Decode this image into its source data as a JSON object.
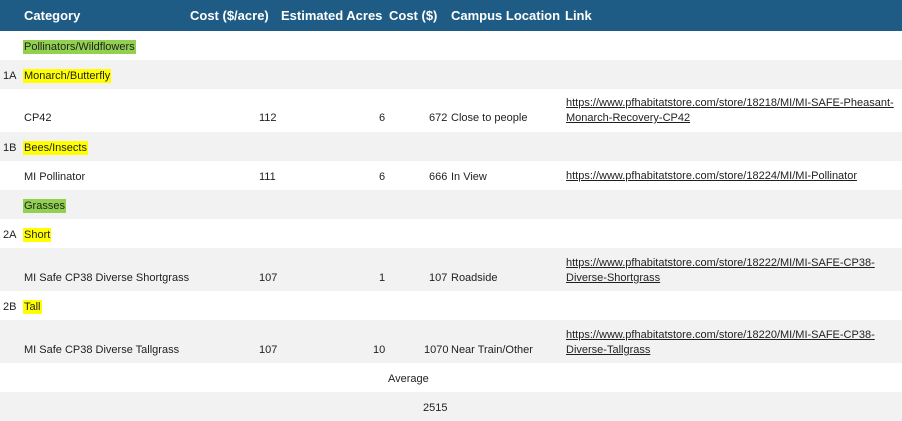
{
  "header": {
    "category": "Category",
    "cost_per_acre": "Cost ($/acre)",
    "estimated_acres": "Estimated Acres",
    "cost": "Cost  ($)",
    "campus_location": "Campus Location",
    "link": "Link"
  },
  "sections": {
    "pollinators": "Pollinators/Wildflowers",
    "grasses": "Grasses"
  },
  "subsections": {
    "s1a_code": "1A",
    "s1a_label": "Monarch/Butterfly",
    "s1b_code": "1B",
    "s1b_label": "Bees/Insects",
    "s2a_code": "2A",
    "s2a_label": "Short",
    "s2b_code": "2B",
    "s2b_label": "Tall"
  },
  "items": [
    {
      "name": "CP42",
      "cost_per_acre": "112",
      "acres": "6",
      "cost": "672",
      "location": "Close to people",
      "link": "https://www.pfhabitatstore.com/store/18218/MI/MI-SAFE-Pheasant-Monarch-Recovery-CP42"
    },
    {
      "name": "MI Pollinator",
      "cost_per_acre": "111",
      "acres": "6",
      "cost": "666",
      "location": "In View",
      "link": "https://www.pfhabitatstore.com/store/18224/MI/MI-Pollinator"
    },
    {
      "name": "MI Safe CP38 Diverse Shortgrass",
      "cost_per_acre": "107",
      "acres": "1",
      "cost": "107",
      "location": "Roadside",
      "link": "https://www.pfhabitatstore.com/store/18222/MI/MI-SAFE-CP38-Diverse-Shortgrass"
    },
    {
      "name": "MI Safe CP38 Diverse Tallgrass",
      "cost_per_acre": "107",
      "acres": "10",
      "cost": "1070",
      "location": "Near Train/Other",
      "link": "https://www.pfhabitatstore.com/store/18220/MI/MI-SAFE-CP38-Diverse-Tallgrass"
    }
  ],
  "summary": {
    "average_label": "Average",
    "total": "2515"
  },
  "colors": {
    "header_bg": "#1f5c85",
    "band_bg": "#f2f2f2",
    "highlight_green": "#92d050",
    "highlight_yellow": "#ffff00"
  }
}
